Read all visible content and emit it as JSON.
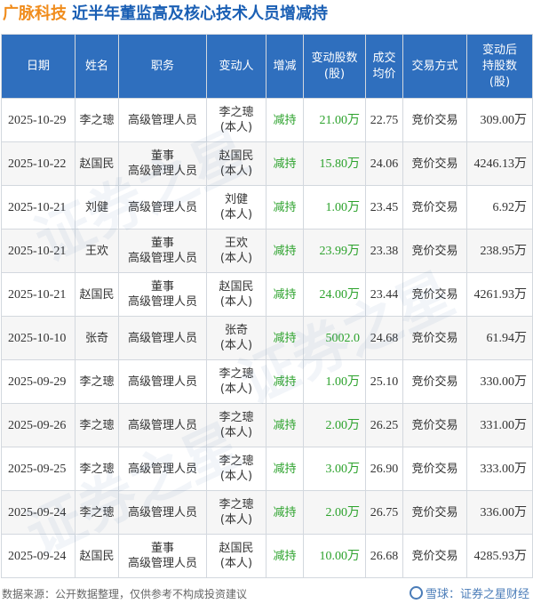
{
  "title": {
    "company": "广脉科技",
    "main": "近半年董监高及核心技术人员增减持"
  },
  "columns": [
    "日期",
    "姓名",
    "职务",
    "变动人",
    "增减",
    "变动股数\n(股)",
    "成交\n均价",
    "交易方式",
    "变动后\n持股数\n(股)"
  ],
  "rows": [
    {
      "date": "2025-10-29",
      "name": "李之璁",
      "role": "高级管理人员",
      "changer": "李之璁\n(本人)",
      "direction": "减持",
      "shares": "21.00万",
      "price": "22.75",
      "method": "竞价交易",
      "after": "309.00万"
    },
    {
      "date": "2025-10-22",
      "name": "赵国民",
      "role": "董事\n高级管理人员",
      "changer": "赵国民\n(本人)",
      "direction": "减持",
      "shares": "15.80万",
      "price": "24.06",
      "method": "竞价交易",
      "after": "4246.13万"
    },
    {
      "date": "2025-10-21",
      "name": "刘健",
      "role": "高级管理人员",
      "changer": "刘健\n(本人)",
      "direction": "减持",
      "shares": "1.00万",
      "price": "23.45",
      "method": "竞价交易",
      "after": "6.92万"
    },
    {
      "date": "2025-10-21",
      "name": "王欢",
      "role": "董事\n高级管理人员",
      "changer": "王欢\n(本人)",
      "direction": "减持",
      "shares": "23.99万",
      "price": "23.38",
      "method": "竞价交易",
      "after": "238.95万"
    },
    {
      "date": "2025-10-21",
      "name": "赵国民",
      "role": "董事\n高级管理人员",
      "changer": "赵国民\n(本人)",
      "direction": "减持",
      "shares": "24.00万",
      "price": "23.44",
      "method": "竞价交易",
      "after": "4261.93万"
    },
    {
      "date": "2025-10-10",
      "name": "张奇",
      "role": "高级管理人员",
      "changer": "张奇\n(本人)",
      "direction": "减持",
      "shares": "5002.0",
      "price": "24.68",
      "method": "竞价交易",
      "after": "61.94万"
    },
    {
      "date": "2025-09-29",
      "name": "李之璁",
      "role": "高级管理人员",
      "changer": "李之璁\n(本人)",
      "direction": "减持",
      "shares": "1.00万",
      "price": "25.10",
      "method": "竞价交易",
      "after": "330.00万"
    },
    {
      "date": "2025-09-26",
      "name": "李之璁",
      "role": "高级管理人员",
      "changer": "李之璁\n(本人)",
      "direction": "减持",
      "shares": "2.00万",
      "price": "26.25",
      "method": "竞价交易",
      "after": "331.00万"
    },
    {
      "date": "2025-09-25",
      "name": "李之璁",
      "role": "高级管理人员",
      "changer": "李之璁\n(本人)",
      "direction": "减持",
      "shares": "3.00万",
      "price": "26.90",
      "method": "竞价交易",
      "after": "333.00万"
    },
    {
      "date": "2025-09-24",
      "name": "李之璁",
      "role": "高级管理人员",
      "changer": "李之璁\n(本人)",
      "direction": "减持",
      "shares": "2.00万",
      "price": "26.75",
      "method": "竞价交易",
      "after": "336.00万"
    },
    {
      "date": "2025-09-24",
      "name": "赵国民",
      "role": "董事\n高级管理人员",
      "changer": "赵国民\n(本人)",
      "direction": "减持",
      "shares": "10.00万",
      "price": "26.68",
      "method": "竞价交易",
      "after": "4285.93万"
    }
  ],
  "colors": {
    "header_bg": "#2f6fbe",
    "company": "#f08c1c",
    "title": "#1a5fb4",
    "decrease": "#2ca22c"
  },
  "footer": {
    "source": "数据来源：公开数据整理，仅供参考不构成投资建议",
    "brand": "雪球：证券之星财经"
  },
  "watermark": "证券之星"
}
